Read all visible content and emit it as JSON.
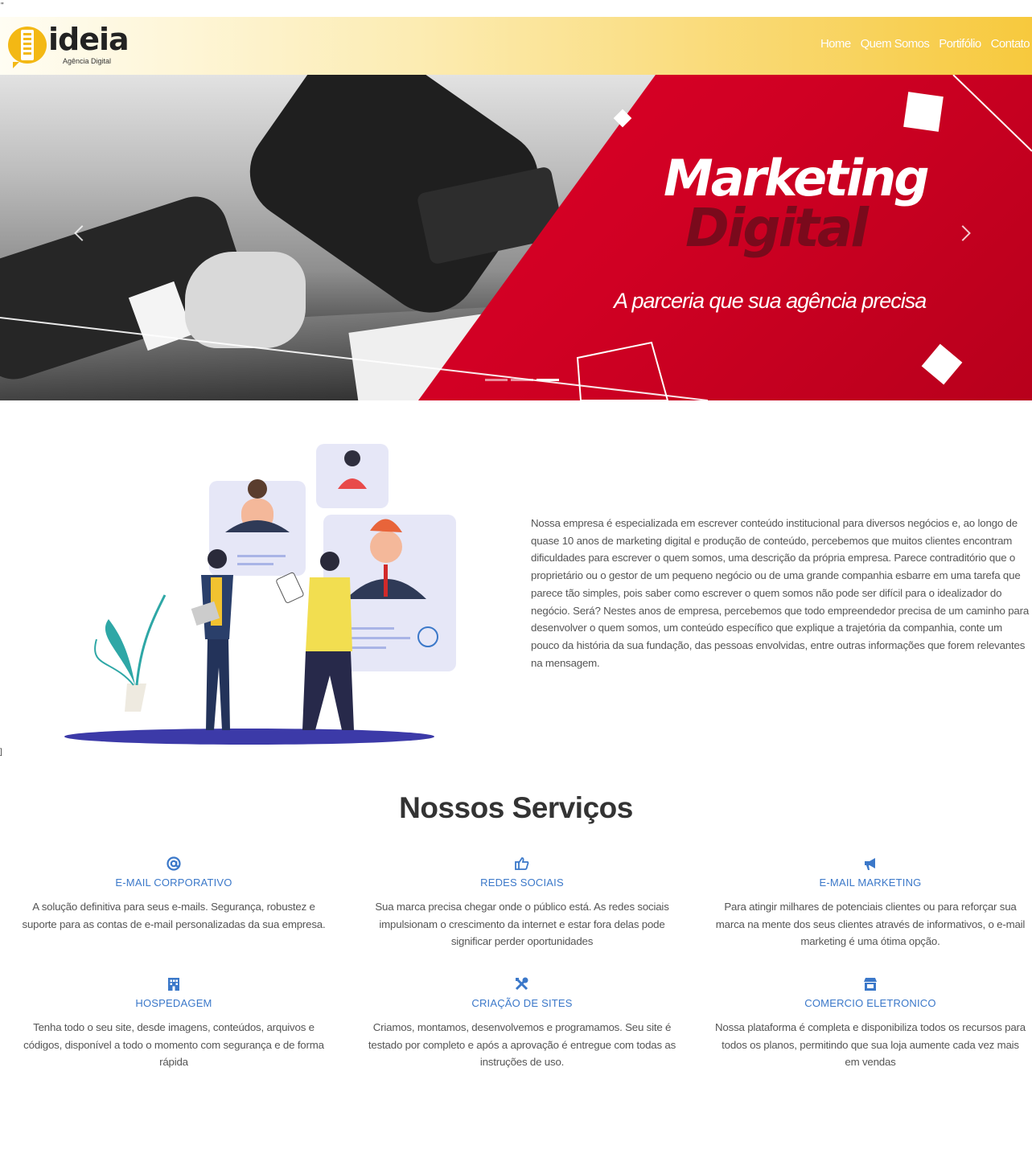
{
  "page": {
    "stray_top": "\"",
    "stray_mid": "]"
  },
  "header": {
    "logo_text": "ideia",
    "logo_subtitle": "Agência Digital",
    "nav": [
      {
        "label": "Home"
      },
      {
        "label": "Quem Somos"
      },
      {
        "label": "Portifólio"
      },
      {
        "label": "Contato"
      }
    ]
  },
  "hero": {
    "title_line1": "Marketing",
    "title_line2": "Digital",
    "tagline": "A parceria que sua agência precisa",
    "slide_count": 3,
    "active_slide": 3
  },
  "about": {
    "text": "Nossa empresa é especializada em escrever conteúdo institucional para diversos negócios e, ao longo de quase 10 anos de marketing digital e produção de conteúdo, percebemos que muitos clientes encontram dificuldades para escrever o quem somos, uma descrição da própria empresa. Parece contraditório que o proprietário ou o gestor de um pequeno negócio ou de uma grande companhia esbarre em uma tarefa que parece tão simples, pois saber como escrever o quem somos não pode ser difícil para o idealizador do negócio. Será? Nestes anos de empresa, percebemos que todo empreendedor precisa de um caminho para desenvolver o quem somos, um conteúdo específico que explique a trajetória da companhia, conte um pouco da história da sua fundação, das pessoas envolvidas, entre outras informações que forem relevantes na mensagem."
  },
  "services": {
    "title": "Nossos Serviços",
    "accent_color": "#3b78c9",
    "items": [
      {
        "icon": "at-icon",
        "title": "E-MAIL CORPORATIVO",
        "desc": "A solução definitiva para seus e-mails. Segurança, robustez e suporte para as contas de e-mail personalizadas da sua empresa."
      },
      {
        "icon": "thumbs-up-icon",
        "title": "REDES SOCIAIS",
        "desc": "Sua marca precisa chegar onde o público está. As redes sociais impulsionam o crescimento da internet e estar fora delas pode significar perder oportunidades"
      },
      {
        "icon": "megaphone-icon",
        "title": "E-MAIL MARKETING",
        "desc": "Para atingir milhares de potenciais clientes ou para reforçar sua marca na mente dos seus clientes através de informativos, o e-mail marketing é uma ótima opção."
      },
      {
        "icon": "building-icon",
        "title": "HOSPEDAGEM",
        "desc": "Tenha todo o seu site, desde imagens, conteúdos, arquivos e códigos, disponível a todo o momento com segurança e de forma rápida"
      },
      {
        "icon": "tools-icon",
        "title": "CRIAÇÃO DE SITES",
        "desc": "Criamos, montamos, desenvolvemos e programamos. Seu site é testado por completo e após a aprovação é entregue com todas as instruções de uso."
      },
      {
        "icon": "store-icon",
        "title": "COMERCIO ELETRONICO",
        "desc": "Nossa plataforma é completa e disponibiliza todos os recursos para todos os planos, permitindo que sua loja aumente cada vez mais em vendas"
      }
    ]
  }
}
